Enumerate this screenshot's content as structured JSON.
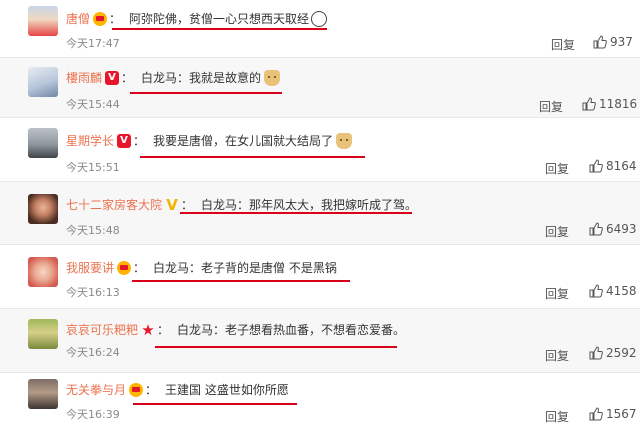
{
  "comments": [
    {
      "user": "唐僧",
      "text": "阿弥陀佛，贫僧一心只想西天取经",
      "time": "今天17:47",
      "reply": "回复",
      "likes": "937",
      "badge": "crown",
      "emoji": "tail"
    },
    {
      "user": "樓雨麟",
      "text": "白龙马：我就是故意的",
      "time": "今天15:44",
      "reply": "回复",
      "likes": "11816",
      "badge": "v-red",
      "emoji": "doge"
    },
    {
      "user": "星期学长",
      "text": "我要是唐僧，在女儿国就大结局了",
      "time": "今天15:51",
      "reply": "回复",
      "likes": "8164",
      "badge": "v-red",
      "emoji": "doge"
    },
    {
      "user": "七十二家房客大院",
      "text": "白龙马：那年风太大，我把嫁听成了驾。",
      "time": "今天15:48",
      "reply": "回复",
      "likes": "6493",
      "badge": "v-yellow",
      "emoji": ""
    },
    {
      "user": "我服要讲",
      "text": "白龙马：老子背的是唐僧 不是黑锅",
      "time": "今天16:13",
      "reply": "回复",
      "likes": "4158",
      "badge": "crown",
      "emoji": ""
    },
    {
      "user": "哀哀可乐粑粑",
      "text": "白龙马：老子想看热血番，不想看恋爱番。",
      "time": "今天16:24",
      "reply": "回复",
      "likes": "2592",
      "badge": "star",
      "emoji": ""
    },
    {
      "user": "无关拳与月",
      "text": "王建国 这盛世如你所愿",
      "time": "今天16:39",
      "reply": "回复",
      "likes": "1567",
      "badge": "crown",
      "emoji": ""
    }
  ],
  "colors": {
    "username": "#eb7350",
    "underline": "#d9001b",
    "text": "#333333",
    "time": "#8a8a8a"
  }
}
